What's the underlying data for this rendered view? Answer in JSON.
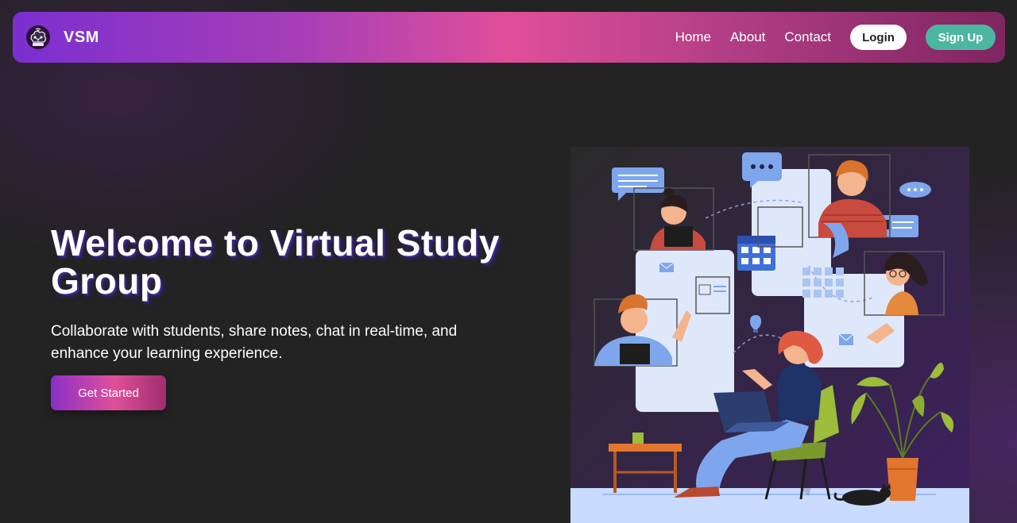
{
  "navbar": {
    "brand_name": "VSM",
    "logo_icon": "brain-circuit-logo-icon",
    "links": [
      "Home",
      "About",
      "Contact"
    ],
    "login_label": "Login",
    "signup_label": "Sign Up"
  },
  "hero": {
    "title": "Welcome to Virtual Study Group",
    "subtitle": "Collaborate with students, share notes, chat in real-time, and enhance your learning experience.",
    "cta_label": "Get Started"
  },
  "colors": {
    "background": "#232323",
    "nav_gradient_start": "#7b2fd0",
    "nav_gradient_mid": "#e04f9a",
    "nav_gradient_end": "#7f2560",
    "signup_button": "#4db6a1",
    "title_shadow": "#3a2a8a"
  }
}
